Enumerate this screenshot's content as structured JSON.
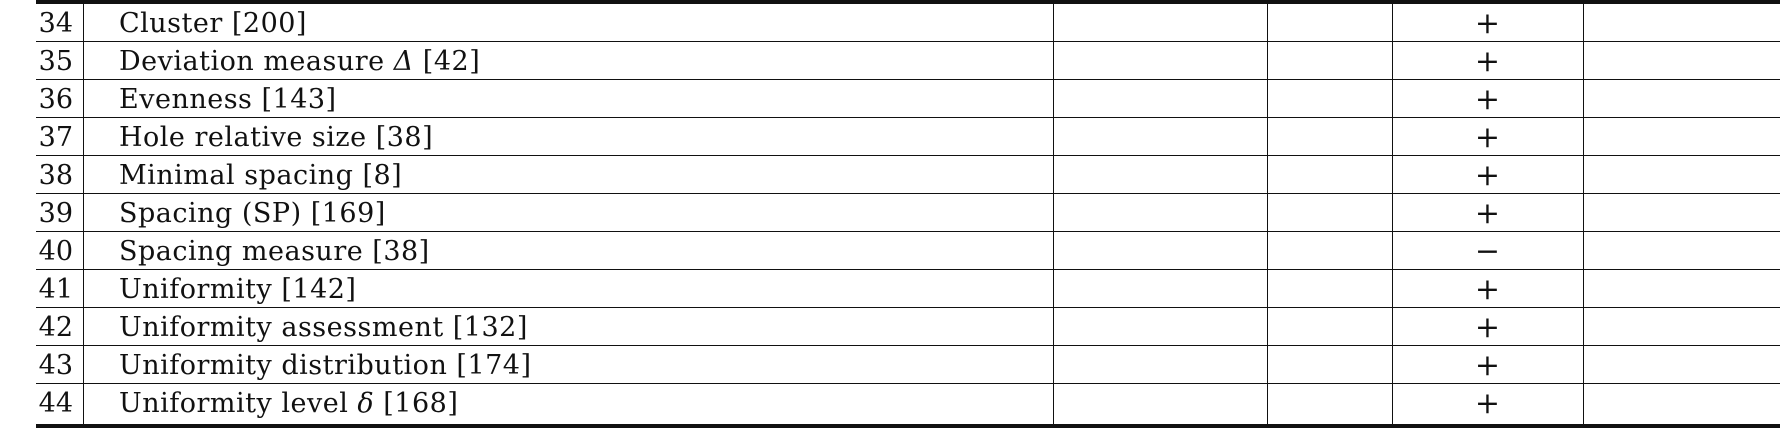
{
  "table": {
    "rows": [
      {
        "num": "34",
        "name": "Cluster [200]",
        "mark": "+"
      },
      {
        "num": "35",
        "name_before": "Deviation measure ",
        "name_math": "Δ",
        "name_after": " [42]",
        "mark": "+"
      },
      {
        "num": "36",
        "name": "Evenness [143]",
        "mark": "+"
      },
      {
        "num": "37",
        "name": "Hole relative size [38]",
        "mark": "+"
      },
      {
        "num": "38",
        "name": "Minimal spacing [8]",
        "mark": "+"
      },
      {
        "num": "39",
        "name": "Spacing (SP) [169]",
        "mark": "+"
      },
      {
        "num": "40",
        "name": "Spacing measure [38]",
        "mark": "−"
      },
      {
        "num": "41",
        "name": "Uniformity [142]",
        "mark": "+"
      },
      {
        "num": "42",
        "name": "Uniformity assessment [132]",
        "mark": "+"
      },
      {
        "num": "43",
        "name": "Uniformity distribution [174]",
        "mark": "+"
      },
      {
        "num": "44",
        "name_before": "Uniformity level ",
        "name_math": "δ",
        "name_after": " [168]",
        "mark": "+"
      }
    ]
  }
}
